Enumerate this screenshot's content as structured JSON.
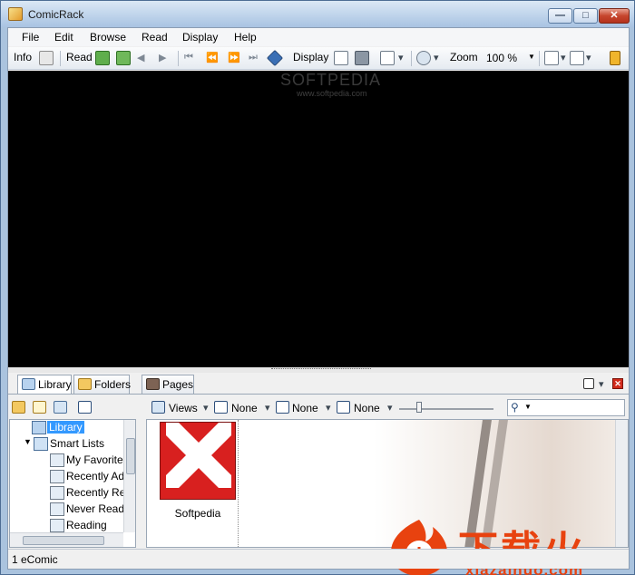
{
  "window": {
    "title": "ComicRack"
  },
  "menu": [
    "File",
    "Edit",
    "Browse",
    "Read",
    "Display",
    "Help"
  ],
  "toolbar": {
    "info_label": "Info",
    "read_label": "Read",
    "display_label": "Display",
    "zoom_label": "Zoom",
    "zoom_value": "100 %"
  },
  "viewer": {
    "watermark": "SOFTPEDIA",
    "watermark_sub": "www.softpedia.com"
  },
  "tabs": {
    "library": "Library",
    "folders": "Folders",
    "pages": "Pages"
  },
  "tree": {
    "items": [
      {
        "label": "Library",
        "selected": true
      },
      {
        "label": "Smart Lists"
      },
      {
        "label": "My Favorite"
      },
      {
        "label": "Recently Ad"
      },
      {
        "label": "Recently Re"
      },
      {
        "label": "Never Read"
      },
      {
        "label": "Reading"
      }
    ]
  },
  "list_toolbar": {
    "views_label": "Views",
    "group_label": "None",
    "stack_label": "None",
    "sort_label": "None"
  },
  "content": {
    "cover_title": "Softpedia"
  },
  "status": {
    "text": "1 eComic"
  },
  "overlay_logo": {
    "cn": "下载火",
    "en": "xiazaihuo.com"
  },
  "colors": {
    "accent": "#3399ff",
    "brand": "#e8420f",
    "cover": "#d8201f"
  }
}
